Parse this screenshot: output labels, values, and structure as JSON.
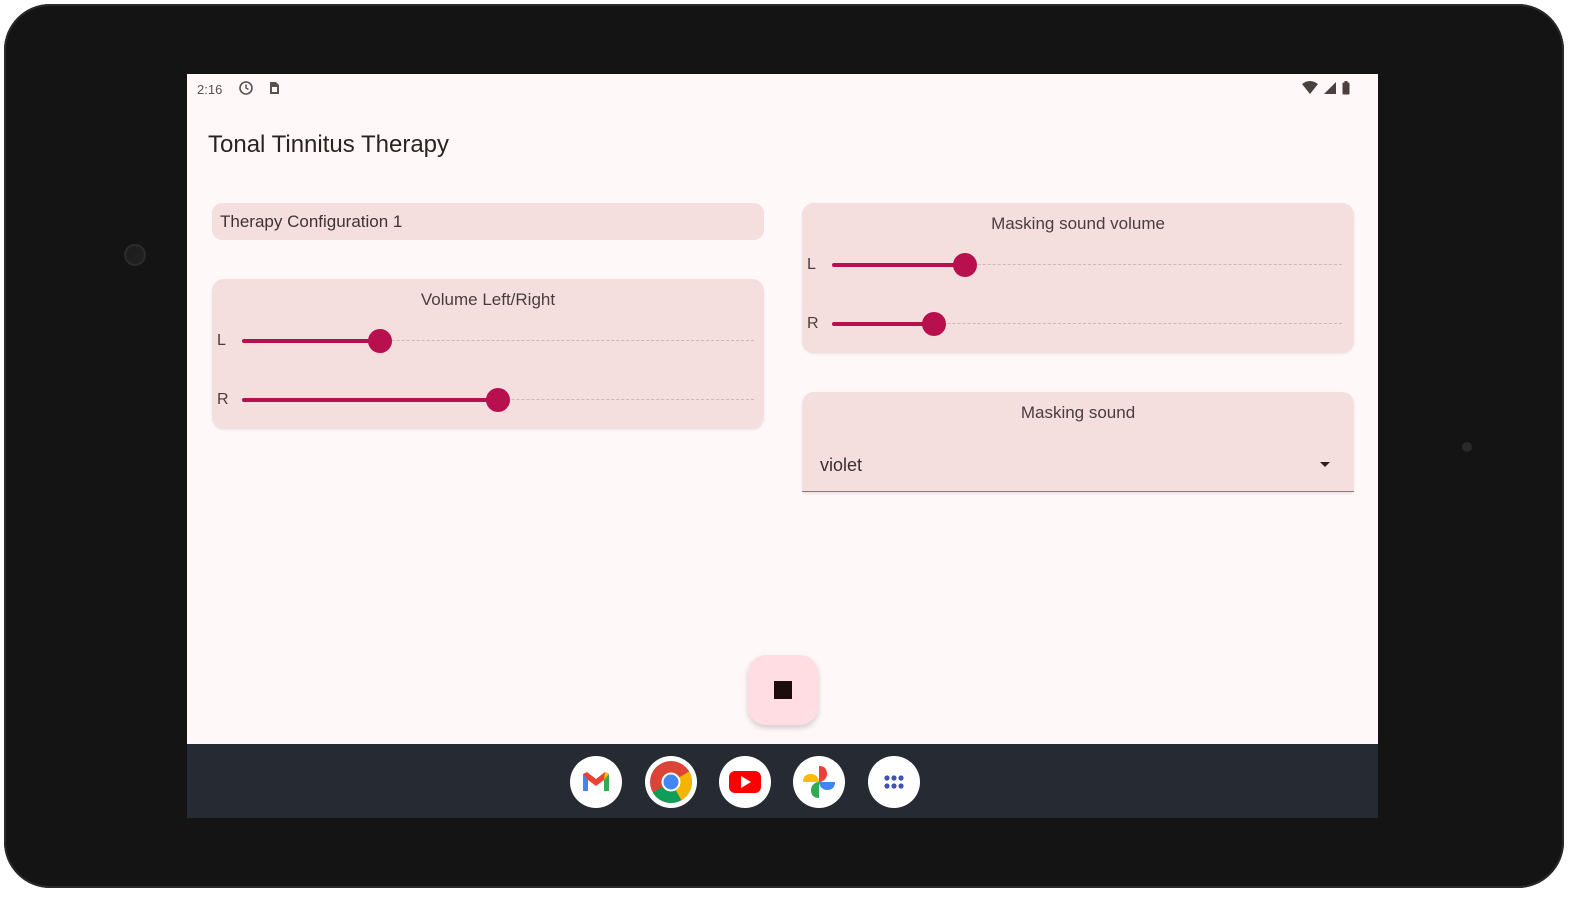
{
  "status_bar": {
    "time": "2:16"
  },
  "app": {
    "title": "Tonal Tinnitus Therapy"
  },
  "config": {
    "name": "Therapy Configuration 1"
  },
  "volume_card": {
    "title": "Volume Left/Right",
    "left_label": "L",
    "right_label": "R",
    "left_level": 0.27,
    "right_level": 0.5
  },
  "masking_volume_card": {
    "title": "Masking sound volume",
    "left_label": "L",
    "right_label": "R",
    "left_level": 0.26,
    "right_level": 0.2
  },
  "masking_sound_card": {
    "title": "Masking sound",
    "selected": "violet"
  },
  "colors": {
    "accent": "#b80f4e",
    "card": "#f4dede",
    "background": "#fff8f8",
    "fab": "#ffdde3",
    "taskbar": "#262b33"
  },
  "dock": {
    "apps": [
      "gmail-icon",
      "chrome-icon",
      "youtube-icon",
      "photos-icon",
      "app-drawer-icon"
    ]
  }
}
